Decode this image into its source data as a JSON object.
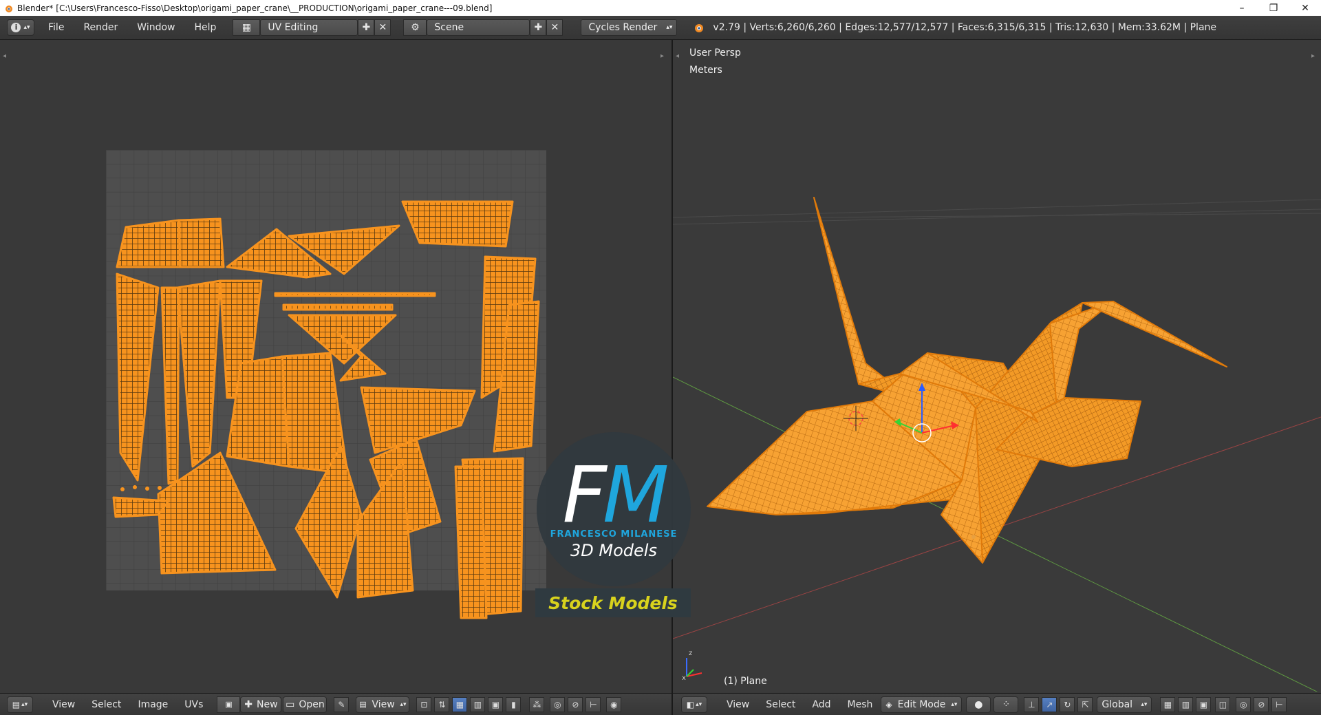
{
  "window": {
    "title": "Blender* [C:\\Users\\Francesco-Fisso\\Desktop\\origami_paper_crane\\__PRODUCTION\\origami_paper_crane---09.blend]",
    "minimize": "–",
    "restore": "❐",
    "close": "✕"
  },
  "info_header": {
    "menus": [
      "File",
      "Render",
      "Window",
      "Help"
    ],
    "screen_layout": "UV Editing",
    "scene": "Scene",
    "render_engine": "Cycles Render",
    "stats": "v2.79 | Verts:6,260/6,260 | Edges:12,577/12,577 | Faces:6,315/6,315 | Tris:12,630 | Mem:33.62M | Plane"
  },
  "view3d": {
    "view_name": "User Persp",
    "units": "Meters",
    "object_info": "(1) Plane"
  },
  "uv_header": {
    "menus": [
      "View",
      "Select",
      "Image",
      "UVs"
    ],
    "new_label": "New",
    "open_label": "Open",
    "view_label": "View"
  },
  "view3d_header": {
    "menus": [
      "View",
      "Select",
      "Add",
      "Mesh"
    ],
    "mode": "Edit Mode",
    "orientation": "Global"
  },
  "watermark": {
    "logo_f": "F",
    "logo_m": "M",
    "brand": "FRANCESCO MILANESE",
    "subtitle": "3D Models",
    "banner": "Stock Models"
  },
  "colors": {
    "mesh_orange": "#f7931e",
    "background": "#393939",
    "accent_blue": "#1fa6dd",
    "banner_yellow": "#d8d21d"
  }
}
